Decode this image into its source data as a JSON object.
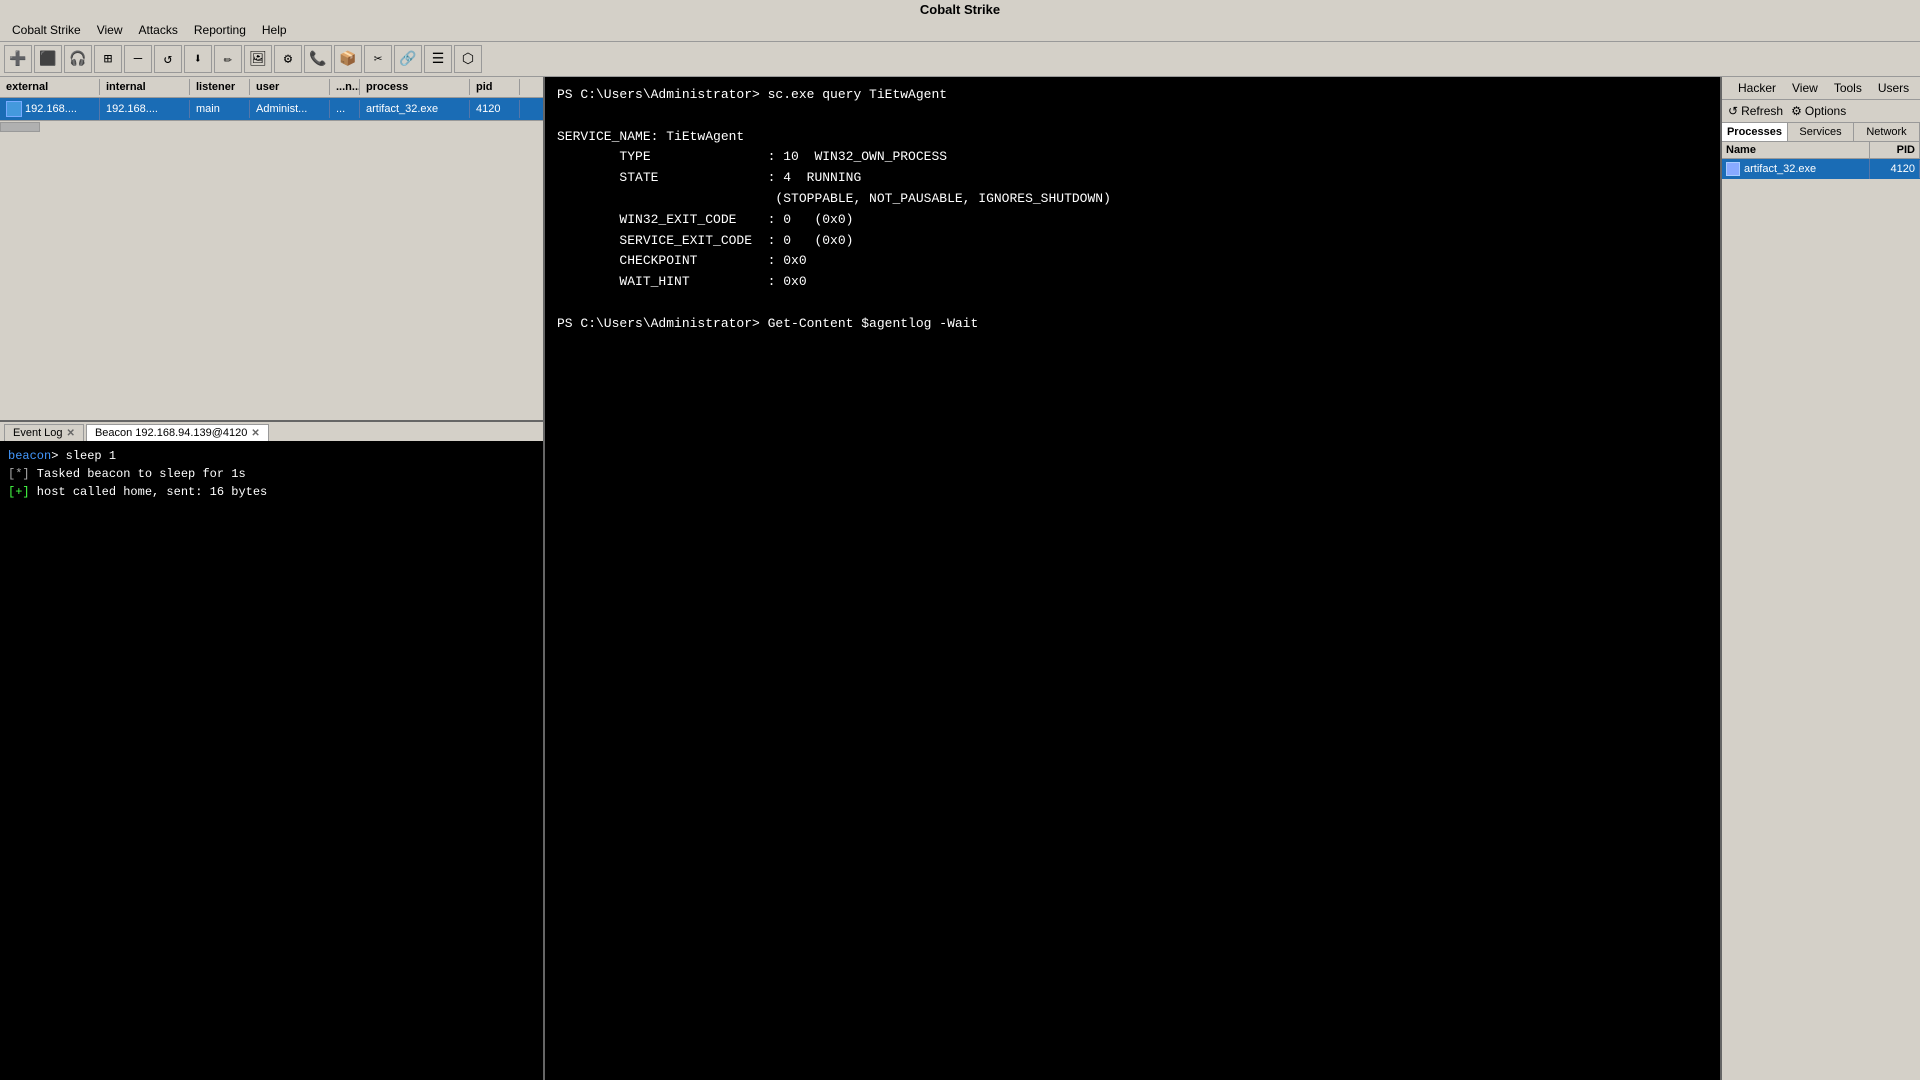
{
  "title": "Cobalt Strike",
  "menu": {
    "items": [
      "Cobalt Strike",
      "View",
      "Attacks",
      "Reporting",
      "Help"
    ]
  },
  "toolbar": {
    "buttons": [
      "+",
      "■",
      "◎",
      "⊞",
      "—",
      "↺",
      "↓",
      "✎",
      "▣",
      "⚙",
      "✆",
      "⊡",
      "✂",
      "⊕",
      "☰",
      "⬟"
    ]
  },
  "sessions_table": {
    "columns": [
      "external",
      "internal",
      "listener",
      "user",
      "...n...",
      "process",
      "pid"
    ],
    "rows": [
      {
        "external": "192.168....",
        "internal": "192.168....",
        "listener": "main",
        "user": "Administ...",
        "note": "...",
        "process": "artifact_32.exe",
        "pid": "4120"
      }
    ]
  },
  "tabs": [
    {
      "label": "Event Log",
      "closeable": true,
      "active": false
    },
    {
      "label": "Beacon 192.168.94.139@4120",
      "closeable": true,
      "active": true
    }
  ],
  "log": {
    "lines": [
      {
        "type": "beacon",
        "text": "beacon> sleep 1"
      },
      {
        "type": "star",
        "text": "[*] Tasked beacon to sleep for 1s"
      },
      {
        "type": "plus",
        "text": "[+] host called home, sent: 16 bytes"
      }
    ]
  },
  "terminal": {
    "lines": [
      {
        "text": "PS C:\\Users\\Administrator> sc.exe query TiEtwAgent",
        "color": "white"
      },
      {
        "text": "",
        "color": "white"
      },
      {
        "text": "SERVICE_NAME: TiEtwAgent",
        "color": "white"
      },
      {
        "text": "        TYPE               : 10  WIN32_OWN_PROCESS",
        "color": "white"
      },
      {
        "text": "        STATE              : 4  RUNNING",
        "color": "white"
      },
      {
        "text": "                            (STOPPABLE, NOT_PAUSABLE, IGNORES_SHUTDOWN)",
        "color": "white"
      },
      {
        "text": "        WIN32_EXIT_CODE    : 0   (0x0)",
        "color": "white"
      },
      {
        "text": "        SERVICE_EXIT_CODE  : 0   (0x0)",
        "color": "white"
      },
      {
        "text": "        CHECKPOINT         : 0x0",
        "color": "white"
      },
      {
        "text": "        WAIT_HINT          : 0x0",
        "color": "white"
      },
      {
        "text": "",
        "color": "white"
      },
      {
        "text": "PS C:\\Users\\Administrator> Get-Content $agentlog -Wait",
        "color": "white"
      }
    ]
  },
  "right_sidebar": {
    "header_buttons": [
      "Refresh",
      "Options"
    ],
    "tabs": [
      "Processes",
      "Services",
      "Network"
    ],
    "active_tab": "Processes",
    "table": {
      "columns": [
        "Name",
        "PID"
      ],
      "rows": [
        {
          "name": "artifact_32.exe",
          "pid": "4120"
        }
      ]
    }
  }
}
